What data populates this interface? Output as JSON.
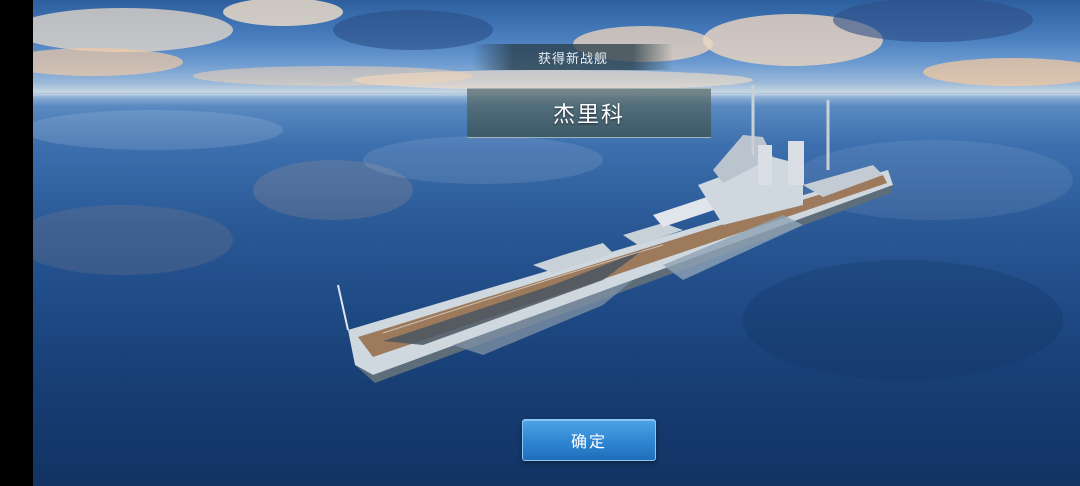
{
  "reward": {
    "header": "获得新战舰",
    "ship_name": "杰里科"
  },
  "actions": {
    "confirm_label": "确定"
  },
  "colors": {
    "sky": "#4a7fbf",
    "sea": "#1f4b86",
    "button": "#2f86d1"
  },
  "icons": {
    "ship": "battleship-model"
  }
}
